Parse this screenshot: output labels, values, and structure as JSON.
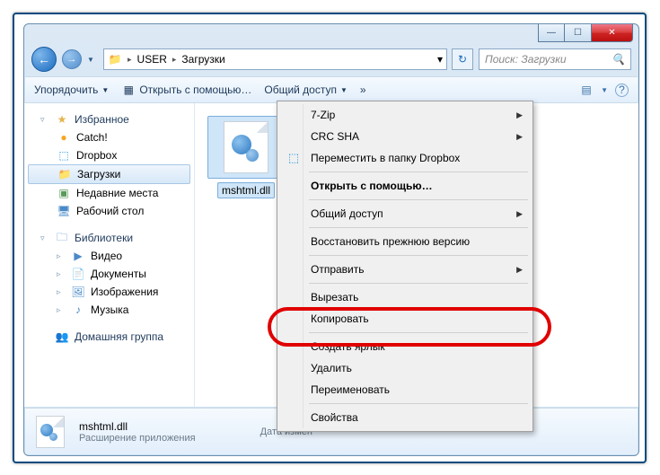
{
  "window": {
    "minimize": "—",
    "maximize": "☐",
    "close": "✕"
  },
  "nav": {
    "back": "←",
    "forward": "→",
    "dropdown": "▼"
  },
  "address": {
    "crumb1": "USER",
    "crumb2": "Загрузки",
    "sep": "▸",
    "drop": "▾",
    "refresh": "↻"
  },
  "search": {
    "placeholder": "Поиск: Загрузки",
    "icon": "🔍"
  },
  "toolbar": {
    "organize": "Упорядочить",
    "open_with": "Открыть с помощью…",
    "share": "Общий доступ",
    "chevron": "»",
    "view_icon": "▤",
    "help_icon": "?"
  },
  "sidebar": {
    "favorites": {
      "label": "Избранное",
      "items": [
        {
          "icon": "●",
          "label": "Catch!",
          "color": "#f5a623"
        },
        {
          "icon": "⬚",
          "label": "Dropbox",
          "color": "#1a8fd8"
        },
        {
          "icon": "📁",
          "label": "Загрузки",
          "color": "#e6b34d",
          "selected": true
        },
        {
          "icon": "▣",
          "label": "Недавние места",
          "color": "#5a9a5a"
        },
        {
          "icon": "🖥",
          "label": "Рабочий стол",
          "color": "#4a8ac8"
        }
      ]
    },
    "libraries": {
      "label": "Библиотеки",
      "items": [
        {
          "icon": "▶",
          "label": "Видео",
          "color": "#4a8ac8"
        },
        {
          "icon": "📄",
          "label": "Документы",
          "color": "#4a8ac8"
        },
        {
          "icon": "🖼",
          "label": "Изображения",
          "color": "#4a8ac8"
        },
        {
          "icon": "♪",
          "label": "Музыка",
          "color": "#4a8ac8"
        }
      ]
    },
    "homegroup": {
      "icon": "👥",
      "label": "Домашняя группа"
    }
  },
  "file": {
    "name": "mshtml.dll"
  },
  "context_menu": {
    "items": [
      {
        "label": "7-Zip",
        "submenu": true
      },
      {
        "label": "CRC SHA",
        "submenu": true
      },
      {
        "label": "Переместить в папку Dropbox",
        "icon": "⬚",
        "icon_color": "#1a8fd8"
      },
      {
        "sep": true
      },
      {
        "label": "Открыть с помощью…",
        "bold": true
      },
      {
        "sep": true
      },
      {
        "label": "Общий доступ",
        "submenu": true
      },
      {
        "sep": true
      },
      {
        "label": "Восстановить прежнюю версию"
      },
      {
        "sep": true
      },
      {
        "label": "Отправить",
        "submenu": true
      },
      {
        "sep": true
      },
      {
        "label": "Вырезать"
      },
      {
        "label": "Копировать",
        "highlighted": true
      },
      {
        "sep": true
      },
      {
        "label": "Создать ярлык"
      },
      {
        "label": "Удалить"
      },
      {
        "label": "Переименовать"
      },
      {
        "sep": true
      },
      {
        "label": "Свойства"
      }
    ]
  },
  "status": {
    "filename": "mshtml.dll",
    "filetype": "Расширение приложения",
    "modified_label": "Дата измен"
  }
}
